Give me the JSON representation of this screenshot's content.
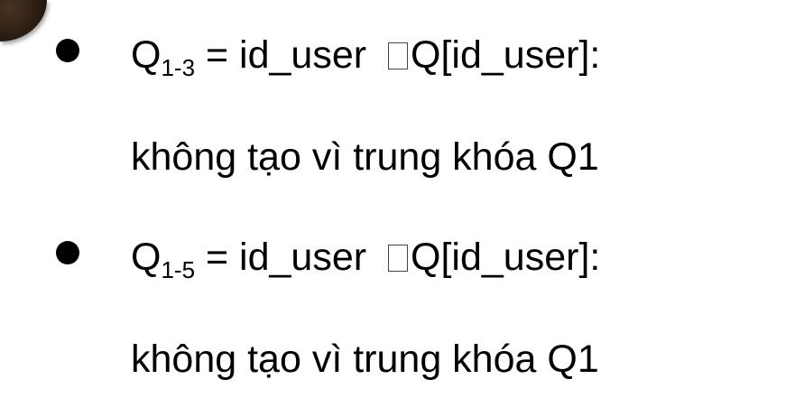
{
  "items": [
    {
      "q": "Q",
      "sub": "1-3",
      "expr": " = id_user ",
      "target": "Q[id_user]:",
      "note": "không tạo vì trung khóa Q1"
    },
    {
      "q": "Q",
      "sub": "1-5",
      "expr": " = id_user ",
      "target": "Q[id_user]:",
      "note": "không tạo vì trung khóa Q1"
    }
  ]
}
